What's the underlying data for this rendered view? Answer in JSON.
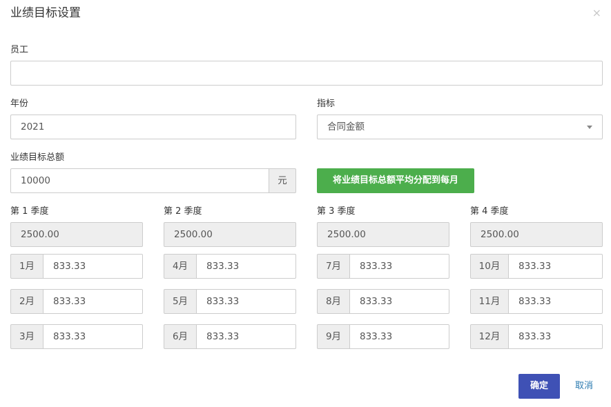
{
  "dialog": {
    "title": "业绩目标设置",
    "close_icon": "×"
  },
  "form": {
    "employee": {
      "label": "员工",
      "value": ""
    },
    "year": {
      "label": "年份",
      "value": "2021"
    },
    "indicator": {
      "label": "指标",
      "selected": "合同金额"
    },
    "total": {
      "label": "业绩目标总额",
      "value": "10000",
      "unit": "元"
    },
    "distribute_button": "将业绩目标总额平均分配到每月"
  },
  "quarters": [
    {
      "label": "第 1 季度",
      "total": "2500.00",
      "months": [
        {
          "label": "1月",
          "value": "833.33"
        },
        {
          "label": "2月",
          "value": "833.33"
        },
        {
          "label": "3月",
          "value": "833.33"
        }
      ]
    },
    {
      "label": "第 2 季度",
      "total": "2500.00",
      "months": [
        {
          "label": "4月",
          "value": "833.33"
        },
        {
          "label": "5月",
          "value": "833.33"
        },
        {
          "label": "6月",
          "value": "833.33"
        }
      ]
    },
    {
      "label": "第 3 季度",
      "total": "2500.00",
      "months": [
        {
          "label": "7月",
          "value": "833.33"
        },
        {
          "label": "8月",
          "value": "833.33"
        },
        {
          "label": "9月",
          "value": "833.33"
        }
      ]
    },
    {
      "label": "第 4 季度",
      "total": "2500.00",
      "months": [
        {
          "label": "10月",
          "value": "833.33"
        },
        {
          "label": "11月",
          "value": "833.33"
        },
        {
          "label": "12月",
          "value": "833.33"
        }
      ]
    }
  ],
  "footer": {
    "confirm": "确定",
    "cancel": "取消"
  },
  "colors": {
    "primary": "#3f51b5",
    "success": "#4cae4c",
    "link": "#2a7ab0"
  }
}
